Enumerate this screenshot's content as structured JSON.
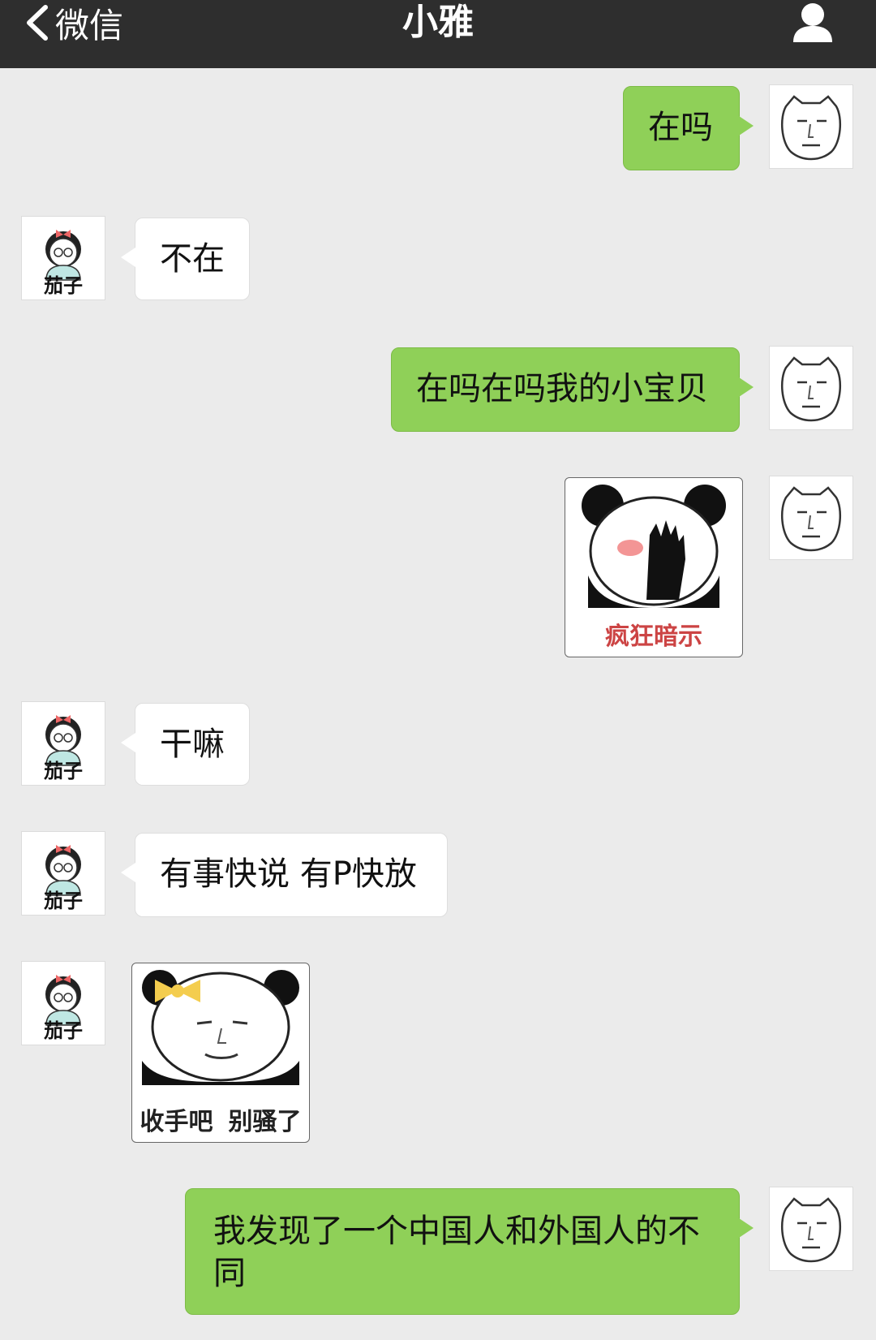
{
  "header": {
    "back_label": "微信",
    "title": "小雅",
    "profile_icon": "person-icon"
  },
  "avatars": {
    "them_name": "茄子"
  },
  "messages": [
    {
      "from": "me",
      "type": "text",
      "text": "在吗"
    },
    {
      "from": "them",
      "type": "text",
      "text": "不在"
    },
    {
      "from": "me",
      "type": "text",
      "text": "在吗在吗我的小宝贝"
    },
    {
      "from": "me",
      "type": "sticker",
      "caption": "疯狂暗示"
    },
    {
      "from": "them",
      "type": "text",
      "text": "干嘛"
    },
    {
      "from": "them",
      "type": "text",
      "text": "有事快说 有P快放"
    },
    {
      "from": "them",
      "type": "sticker",
      "caption_left": "收手吧",
      "caption_right": "别骚了"
    },
    {
      "from": "me",
      "type": "text",
      "text": "我发现了一个中国人和外国人的不同"
    }
  ],
  "colors": {
    "navbar": "#2e2e2e",
    "background": "#ebebeb",
    "my_bubble": "#8fd058",
    "their_bubble": "#ffffff"
  }
}
